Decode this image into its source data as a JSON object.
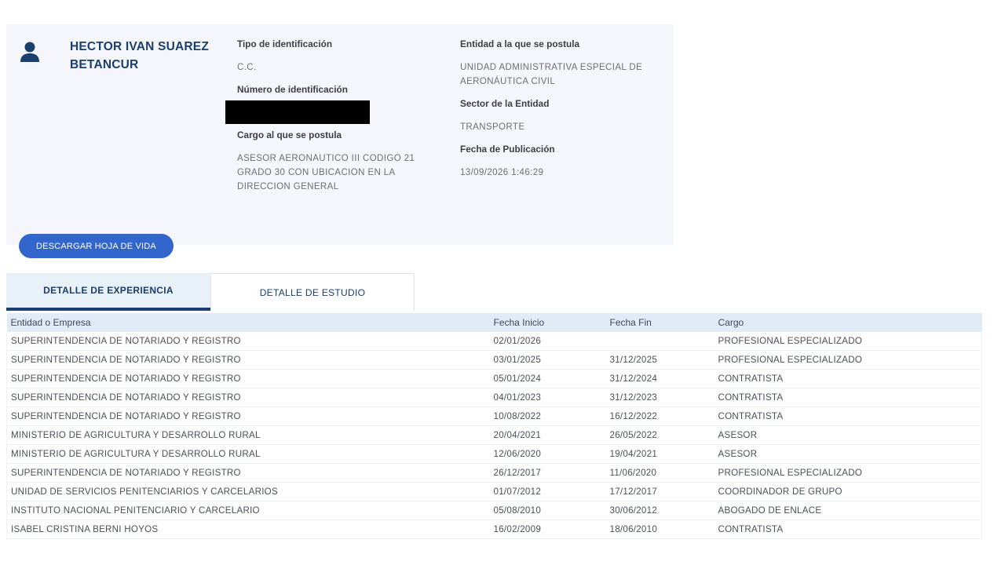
{
  "profile": {
    "name": "HECTOR IVAN SUAREZ BETANCUR",
    "id_type_label": "Tipo de identificación",
    "id_type_value": "C.C.",
    "id_number_label": "Número de identificación",
    "position_label": "Cargo al que se postula",
    "position_value": "ASESOR AERONAUTICO III CODIGO 21 GRADO 30 CON UBICACION EN LA DIRECCION GENERAL",
    "entity_label": "Entidad a la que se postula",
    "entity_value": "UNIDAD ADMINISTRATIVA ESPECIAL DE AERONÁUTICA CIVIL",
    "sector_label": "Sector de la Entidad",
    "sector_value": "TRANSPORTE",
    "pub_date_label": "Fecha de Publicación",
    "pub_date_value": "13/09/2026 1:46:29"
  },
  "download_button": "DESCARGAR HOJA DE VIDA",
  "tabs": [
    {
      "label": "DETALLE DE EXPERIENCIA",
      "active": true
    },
    {
      "label": "DETALLE DE ESTUDIO",
      "active": false
    }
  ],
  "table": {
    "columns": [
      "Entidad o Empresa",
      "Fecha Inicio",
      "Fecha Fin",
      "Cargo"
    ],
    "rows": [
      [
        "SUPERINTENDENCIA DE NOTARIADO Y REGISTRO",
        "02/01/2026",
        "",
        "PROFESIONAL ESPECIALIZADO"
      ],
      [
        "SUPERINTENDENCIA DE NOTARIADO Y REGISTRO",
        "03/01/2025",
        "31/12/2025",
        "PROFESIONAL ESPECIALIZADO"
      ],
      [
        "SUPERINTENDENCIA DE NOTARIADO Y REGISTRO",
        "05/01/2024",
        "31/12/2024",
        "CONTRATISTA"
      ],
      [
        "SUPERINTENDENCIA DE NOTARIADO Y REGISTRO",
        "04/01/2023",
        "31/12/2023",
        "CONTRATISTA"
      ],
      [
        "SUPERINTENDENCIA DE NOTARIADO Y REGISTRO",
        "10/08/2022",
        "16/12/2022",
        "CONTRATISTA"
      ],
      [
        "MINISTERIO DE AGRICULTURA Y DESARROLLO RURAL",
        "20/04/2021",
        "26/05/2022",
        "ASESOR"
      ],
      [
        "MINISTERIO DE AGRICULTURA Y DESARROLLO RURAL",
        "12/06/2020",
        "19/04/2021",
        "ASESOR"
      ],
      [
        "SUPERINTENDENCIA DE NOTARIADO Y REGISTRO",
        "26/12/2017",
        "11/06/2020",
        "PROFESIONAL ESPECIALIZADO"
      ],
      [
        "UNIDAD DE SERVICIOS PENITENCIARIOS Y CARCELARIOS",
        "01/07/2012",
        "17/12/2017",
        "COORDINADOR DE GRUPO"
      ],
      [
        "INSTITUTO NACIONAL PENITENCIARIO Y CARCELARIO",
        "05/08/2010",
        "30/06/2012",
        "ABOGADO DE ENLACE"
      ],
      [
        "ISABEL CRISTINA BERNI HOYOS",
        "16/02/2009",
        "18/06/2010",
        "CONTRATISTA"
      ]
    ]
  },
  "icons": {
    "avatar": "user-icon"
  },
  "colors": {
    "primary_dark": "#1a3e6e",
    "button": "#3366cc",
    "card_bg": "#f4f6f9",
    "table_header": "#e0ebf6"
  }
}
